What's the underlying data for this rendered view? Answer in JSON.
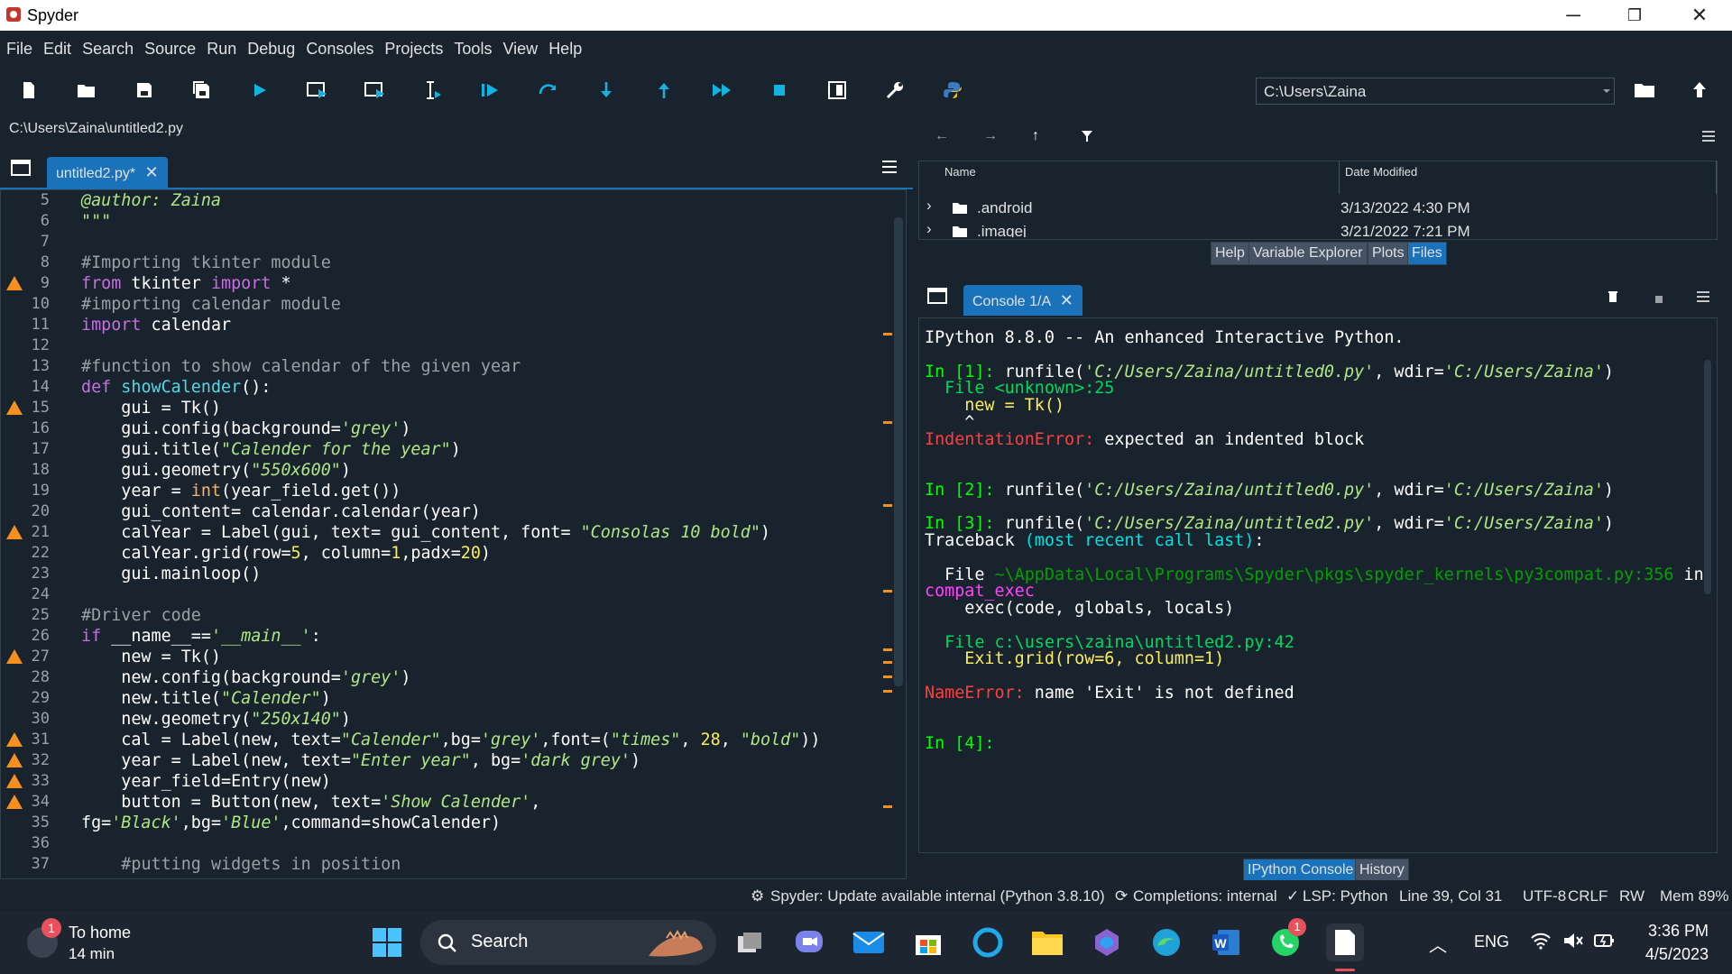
{
  "window": {
    "title": "Spyder",
    "minimize_glyph": "─",
    "maximize_glyph": "❐",
    "close_glyph": "✕"
  },
  "menu": [
    "File",
    "Edit",
    "Search",
    "Source",
    "Run",
    "Debug",
    "Consoles",
    "Projects",
    "Tools",
    "View",
    "Help"
  ],
  "toolbar": {
    "path_value": "C:\\Users\\Zaina",
    "icons": [
      "new-file-icon",
      "open-file-icon",
      "save-icon",
      "save-all-icon",
      "run-icon",
      "run-cell-icon",
      "run-cell-advance-icon",
      "run-selection-icon",
      "debug-icon",
      "step-icon",
      "step-into-icon",
      "step-return-icon",
      "continue-icon",
      "stop-icon",
      "maximize-pane-icon",
      "preferences-icon",
      "python-path-icon"
    ]
  },
  "editor": {
    "filepath": "C:\\Users\\Zaina\\untitled2.py",
    "tab_label": "untitled2.py*",
    "lines": [
      {
        "n": "5",
        "t": [
          [
            "dec",
            "@author: Zaina"
          ]
        ]
      },
      {
        "n": "6",
        "t": [
          [
            "str",
            "\"\"\""
          ]
        ]
      },
      {
        "n": "7",
        "t": []
      },
      {
        "n": "8",
        "t": [
          [
            "com",
            "#Importing tkinter module"
          ]
        ]
      },
      {
        "n": "9",
        "w": true,
        "t": [
          [
            "kw",
            "from"
          ],
          [
            "pl",
            " tkinter "
          ],
          [
            "kw",
            "import"
          ],
          [
            "pl",
            " *"
          ]
        ]
      },
      {
        "n": "10",
        "t": [
          [
            "com",
            "#importing calendar module"
          ]
        ]
      },
      {
        "n": "11",
        "t": [
          [
            "kw",
            "import"
          ],
          [
            "pl",
            " calendar"
          ]
        ]
      },
      {
        "n": "12",
        "t": []
      },
      {
        "n": "13",
        "t": [
          [
            "com",
            "#function to show calendar of the given year"
          ]
        ]
      },
      {
        "n": "14",
        "t": [
          [
            "kw",
            "def"
          ],
          [
            "pl",
            " "
          ],
          [
            "fn",
            "showCalender"
          ],
          [
            "pl",
            "():"
          ]
        ]
      },
      {
        "n": "15",
        "w": true,
        "t": [
          [
            "pl",
            "    gui = Tk()"
          ]
        ]
      },
      {
        "n": "16",
        "t": [
          [
            "pl",
            "    gui.config(background="
          ],
          [
            "str",
            "'grey'"
          ],
          [
            "pl",
            ")"
          ]
        ]
      },
      {
        "n": "17",
        "t": [
          [
            "pl",
            "    gui.title("
          ],
          [
            "str",
            "\"Calender for the year\""
          ],
          [
            "pl",
            ")"
          ]
        ]
      },
      {
        "n": "18",
        "t": [
          [
            "pl",
            "    gui.geometry("
          ],
          [
            "str",
            "\"550x600\""
          ],
          [
            "pl",
            ")"
          ]
        ]
      },
      {
        "n": "19",
        "t": [
          [
            "pl",
            "    year = "
          ],
          [
            "bi",
            "int"
          ],
          [
            "pl",
            "(year_field.get())"
          ]
        ]
      },
      {
        "n": "20",
        "t": [
          [
            "pl",
            "    gui_content= calendar.calendar(year)"
          ]
        ]
      },
      {
        "n": "21",
        "w": true,
        "t": [
          [
            "pl",
            "    calYear = Label(gui, text= gui_content, font= "
          ],
          [
            "str",
            "\"Consolas 10 bold\""
          ],
          [
            "pl",
            ")"
          ]
        ]
      },
      {
        "n": "22",
        "t": [
          [
            "pl",
            "    calYear.grid(row="
          ],
          [
            "num",
            "5"
          ],
          [
            "pl",
            ", column="
          ],
          [
            "num",
            "1"
          ],
          [
            "pl",
            ",padx="
          ],
          [
            "num",
            "20"
          ],
          [
            "pl",
            ")"
          ]
        ]
      },
      {
        "n": "23",
        "t": [
          [
            "pl",
            "    gui.mainloop()"
          ]
        ]
      },
      {
        "n": "24",
        "t": []
      },
      {
        "n": "25",
        "t": [
          [
            "com",
            "#Driver code"
          ]
        ]
      },
      {
        "n": "26",
        "t": [
          [
            "kw",
            "if"
          ],
          [
            "pl",
            " __name__=="
          ],
          [
            "str",
            "'__main__'"
          ],
          [
            "pl",
            ":"
          ]
        ]
      },
      {
        "n": "27",
        "w": true,
        "t": [
          [
            "pl",
            "    new = Tk()"
          ]
        ]
      },
      {
        "n": "28",
        "t": [
          [
            "pl",
            "    new.config(background="
          ],
          [
            "str",
            "'grey'"
          ],
          [
            "pl",
            ")"
          ]
        ]
      },
      {
        "n": "29",
        "t": [
          [
            "pl",
            "    new.title("
          ],
          [
            "str",
            "\"Calender\""
          ],
          [
            "pl",
            ")"
          ]
        ]
      },
      {
        "n": "30",
        "t": [
          [
            "pl",
            "    new.geometry("
          ],
          [
            "str",
            "\"250x140\""
          ],
          [
            "pl",
            ")"
          ]
        ]
      },
      {
        "n": "31",
        "w": true,
        "t": [
          [
            "pl",
            "    cal = Label(new, text="
          ],
          [
            "str",
            "\"Calender\""
          ],
          [
            "pl",
            ",bg="
          ],
          [
            "str",
            "'grey'"
          ],
          [
            "pl",
            ",font=("
          ],
          [
            "str",
            "\"times\""
          ],
          [
            "pl",
            ", "
          ],
          [
            "num",
            "28"
          ],
          [
            "pl",
            ", "
          ],
          [
            "str",
            "\"bold\""
          ],
          [
            "pl",
            "))"
          ]
        ]
      },
      {
        "n": "32",
        "w": true,
        "t": [
          [
            "pl",
            "    year = Label(new, text="
          ],
          [
            "str",
            "\"Enter year\""
          ],
          [
            "pl",
            ", bg="
          ],
          [
            "str",
            "'dark grey'"
          ],
          [
            "pl",
            ")"
          ]
        ]
      },
      {
        "n": "33",
        "w": true,
        "t": [
          [
            "pl",
            "    year_field=Entry(new)"
          ]
        ]
      },
      {
        "n": "34",
        "w": true,
        "t": [
          [
            "pl",
            "    button = Button(new, text="
          ],
          [
            "str",
            "'Show Calender'"
          ],
          [
            "pl",
            ","
          ]
        ]
      },
      {
        "n": "35",
        "t": [
          [
            "pl",
            "fg="
          ],
          [
            "str",
            "'Black'"
          ],
          [
            "pl",
            ",bg="
          ],
          [
            "str",
            "'Blue'"
          ],
          [
            "pl",
            ",command=showCalender)"
          ]
        ]
      },
      {
        "n": "36",
        "t": []
      },
      {
        "n": "37",
        "t": [
          [
            "pl",
            "    "
          ],
          [
            "com",
            "#putting widgets in position"
          ]
        ]
      }
    ]
  },
  "files": {
    "columns": [
      "Name",
      "Date Modified"
    ],
    "rows": [
      {
        "name": ".android",
        "date": "3/13/2022 4:30 PM"
      },
      {
        "name": ".imagej",
        "date": "3/21/2022 7:21 PM"
      }
    ],
    "tabs": [
      "Help",
      "Variable Explorer",
      "Plots",
      "Files"
    ],
    "active_tab": "Files"
  },
  "console": {
    "tab_label": "Console 1/A",
    "lines": [
      [
        [
          "pl",
          "IPython 8.8.0 -- An enhanced Interactive Python."
        ]
      ],
      [],
      [
        [
          "green",
          "In [1]: "
        ],
        [
          "pl",
          "runfile("
        ],
        [
          "str",
          "'C:/Users/Zaina/untitled0.py'"
        ],
        [
          "pl",
          ", wdir="
        ],
        [
          "str",
          "'C:/Users/Zaina'"
        ],
        [
          "pl",
          ")"
        ]
      ],
      [
        [
          "grn2",
          "  File "
        ],
        [
          "grn2",
          "<unknown>:25"
        ]
      ],
      [
        [
          "c-y",
          "    new = Tk()"
        ]
      ],
      [
        [
          "pl",
          "    ^"
        ]
      ],
      [
        [
          "red",
          "IndentationError:"
        ],
        [
          "pl",
          " expected an indented block"
        ]
      ],
      [],
      [],
      [
        [
          "green",
          "In [2]: "
        ],
        [
          "pl",
          "runfile("
        ],
        [
          "str",
          "'C:/Users/Zaina/untitled0.py'"
        ],
        [
          "pl",
          ", wdir="
        ],
        [
          "str",
          "'C:/Users/Zaina'"
        ],
        [
          "pl",
          ")"
        ]
      ],
      [],
      [
        [
          "green",
          "In [3]: "
        ],
        [
          "pl",
          "runfile("
        ],
        [
          "str",
          "'C:/Users/Zaina/untitled2.py'"
        ],
        [
          "pl",
          ", wdir="
        ],
        [
          "str",
          "'C:/Users/Zaina'"
        ],
        [
          "pl",
          ")"
        ]
      ],
      [
        [
          "pl",
          "Traceback "
        ],
        [
          "cyan",
          "(most recent call last)"
        ],
        [
          "pl",
          ":"
        ]
      ],
      [],
      [
        [
          "pl",
          "  File "
        ],
        [
          "dk",
          "~\\AppData\\Local\\Programs\\Spyder\\pkgs\\spyder_kernels\\py3compat.py:356"
        ],
        [
          "pl",
          " in"
        ]
      ],
      [
        [
          "mag",
          "compat_exec"
        ]
      ],
      [
        [
          "pl",
          "    exec(code, globals, locals)"
        ]
      ],
      [],
      [
        [
          "grn2",
          "  File "
        ],
        [
          "grn2",
          "c:\\users\\zaina\\untitled2.py:42"
        ]
      ],
      [
        [
          "c-y",
          "    Exit.grid(row=6, column=1)"
        ]
      ],
      [],
      [
        [
          "red",
          "NameError:"
        ],
        [
          "pl",
          " name 'Exit' is not defined"
        ]
      ],
      [],
      [],
      [
        [
          "green",
          "In [4]: "
        ]
      ]
    ],
    "bottom_tabs": [
      "IPython Console",
      "History"
    ],
    "active_tab": "IPython Console"
  },
  "status": {
    "update": "Spyder: Update available",
    "interpreter": "internal (Python 3.8.10)",
    "completions": "Completions: internal",
    "lsp": "LSP: Python",
    "position": "Line 39, Col 31",
    "encoding": "UTF-8",
    "eol": "CRLF",
    "perm": "RW",
    "mem": "Mem 89%"
  },
  "taskbar": {
    "widget_title": "To home",
    "widget_sub": "14 min",
    "widget_badge": "1",
    "search": "Search",
    "whatsapp_badge": "1",
    "lang": "ENG",
    "time": "3:36 PM",
    "date": "4/5/2023"
  },
  "colors": {
    "bg": "#19232d",
    "accent": "#1a72bb",
    "warning": "#f5901e"
  }
}
